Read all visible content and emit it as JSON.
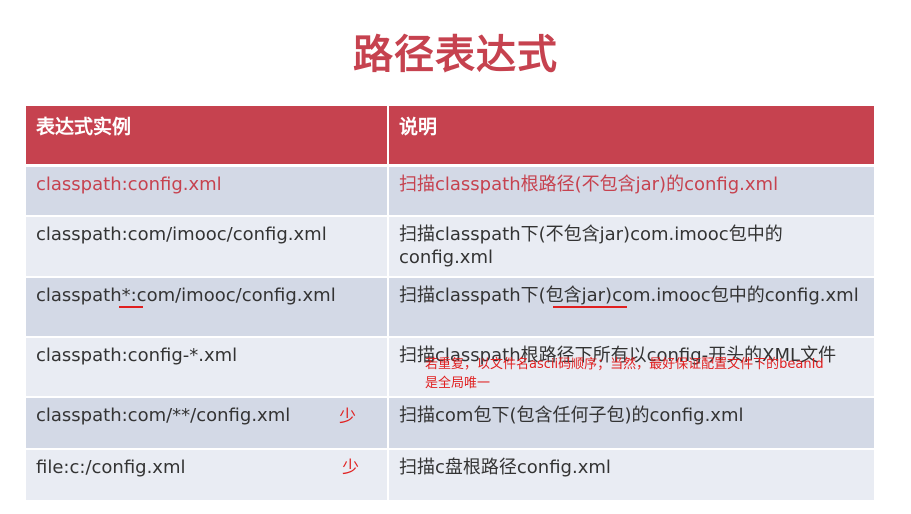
{
  "title": "路径表达式",
  "table": {
    "headers": [
      "表达式实例",
      "说明"
    ],
    "rows": [
      {
        "expr": "classpath:config.xml",
        "desc": "扫描classpath根路径(不包含jar)的config.xml"
      },
      {
        "expr": "classpath:com/imooc/config.xml",
        "desc": "扫描classpath下(不包含jar)com.imooc包中的config.xml"
      },
      {
        "expr": "classpath*:com/imooc/config.xml",
        "desc": "扫描classpath下(包含jar)com.imooc包中的config.xml"
      },
      {
        "expr": "classpath:config-*.xml",
        "desc": "扫描classpath根路径下所有以config-开头的XML文件"
      },
      {
        "expr": "classpath:com/**/config.xml",
        "desc": "扫描com包下(包含任何子包)的config.xml"
      },
      {
        "expr": "file:c:/config.xml",
        "desc": "扫描c盘根路径config.xml"
      }
    ]
  },
  "annotations": {
    "note_line1": "若重复，以文件名ascii码顺序；当然，最好保证配置文件下的beanId",
    "note_line2": "是全局唯一",
    "shao_1": "少",
    "shao_2": "少"
  },
  "colors": {
    "accent": "#c6424f",
    "annotation": "#e02020",
    "row_odd": "#d3d9e6",
    "row_even": "#e9ecf3"
  }
}
